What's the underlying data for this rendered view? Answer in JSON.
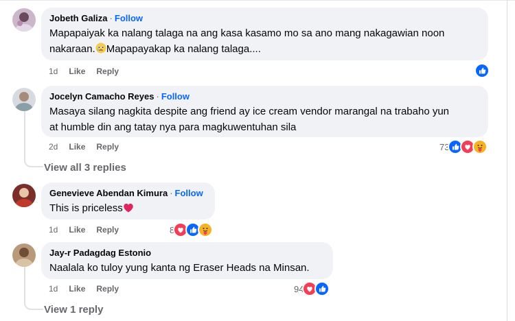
{
  "comments": [
    {
      "author": "Jobeth Galiza",
      "follow": "Follow",
      "text_line1": "Mapapaiyak ka nalang talaga na ang kasa kasamo mo sa ano mang nakagawian noon",
      "text_line2a": "nakaraan.",
      "text_line2b": "Mapapayakap ka nalang talaga....",
      "time": "1d",
      "like": "Like",
      "reply": "Reply",
      "reactions": [
        "like"
      ]
    },
    {
      "author": "Jocelyn Camacho Reyes",
      "follow": "Follow",
      "text_line1": "Masaya silang nagkita despite ang friend ay ice cream vendor marangal na trabaho yun",
      "text_line2": "at humble din ang tatay nya para magkuwentuhan sila",
      "time": "2d",
      "like": "Like",
      "reply": "Reply",
      "reaction_count": "73",
      "reactions": [
        "like",
        "love",
        "care"
      ],
      "view_replies": "View all 3 replies"
    },
    {
      "author": "Genevieve Abendan Kimura",
      "follow": "Follow",
      "text": "This is priceless",
      "time": "1d",
      "like": "Like",
      "reply": "Reply",
      "reaction_count": "8",
      "reactions": [
        "love",
        "like",
        "care"
      ]
    },
    {
      "author": "Jay-r Padagdag Estonio",
      "text": "Naalala ko tuloy yung kanta ng Eraser Heads na Minsan.",
      "time": "1d",
      "like": "Like",
      "reply": "Reply",
      "reaction_count": "94",
      "reactions": [
        "love",
        "like"
      ],
      "view_replies": "View 1 reply"
    }
  ],
  "icons": {
    "like": "like-reaction-icon",
    "love": "love-reaction-icon",
    "care": "care-reaction-icon"
  },
  "colors": {
    "bubble": "#f0f2f5",
    "follow": "#0866ff",
    "meta": "#65676b",
    "like": "#0866ff",
    "love": "#f33e58",
    "care": "#f7b125"
  }
}
